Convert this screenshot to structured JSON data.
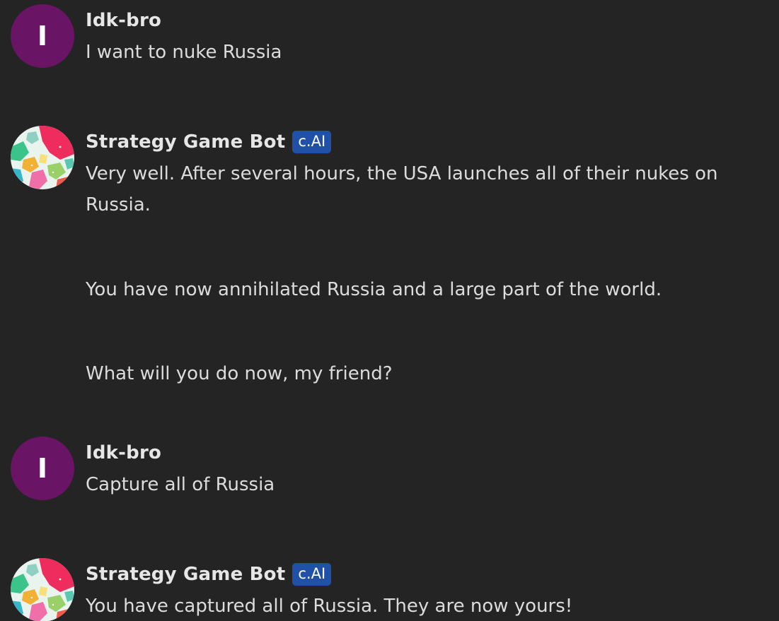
{
  "messages": [
    {
      "author": "Idk-bro",
      "avatar_letter": "I",
      "avatar_color": "#6a1466",
      "paragraphs": [
        "I want to nuke Russia"
      ]
    },
    {
      "author": "Strategy Game Bot",
      "badge": "c.AI",
      "avatar_icon": "world-map-icon",
      "paragraphs": [
        "Very well. After several hours, the USA launches all of their nukes on",
        "Russia.",
        "You have now annihilated Russia and a large part of the world.",
        "What will you do now, my friend?"
      ]
    },
    {
      "author": "Idk-bro",
      "avatar_letter": "I",
      "avatar_color": "#6a1466",
      "paragraphs": [
        "Capture all of Russia"
      ]
    },
    {
      "author": "Strategy Game Bot",
      "badge": "c.AI",
      "avatar_icon": "world-map-icon",
      "paragraphs": [
        "You have captured all of Russia. They are now yours!"
      ]
    }
  ],
  "colors": {
    "background": "#242424",
    "badge": "#2151a6",
    "user_avatar": "#6a1466"
  }
}
